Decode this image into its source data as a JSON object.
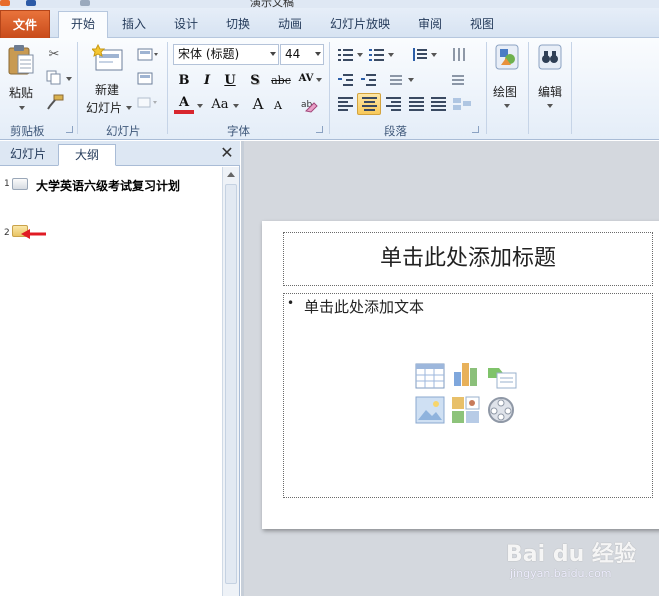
{
  "app": {
    "title_fragment": "演示文稿"
  },
  "tabs": [
    {
      "label": "文件"
    },
    {
      "label": "开始"
    },
    {
      "label": "插入"
    },
    {
      "label": "设计"
    },
    {
      "label": "切换"
    },
    {
      "label": "动画"
    },
    {
      "label": "幻灯片放映"
    },
    {
      "label": "审阅"
    },
    {
      "label": "视图"
    }
  ],
  "ribbon": {
    "clipboard": {
      "paste": "粘贴",
      "group": "剪贴板"
    },
    "slides": {
      "new_line1": "新建",
      "new_line2": "幻灯片",
      "group": "幻灯片"
    },
    "font": {
      "name": "宋体 (标题)",
      "size": "44",
      "bold": "B",
      "italic": "I",
      "underline": "U",
      "shadow": "S",
      "strike": "abc",
      "spacing": "AV",
      "color": "A",
      "case": "Aa",
      "grow": "A",
      "shrink": "A",
      "group": "字体"
    },
    "paragraph": {
      "group": "段落"
    },
    "drawing": {
      "label": "绘图"
    },
    "editing": {
      "label": "编辑"
    }
  },
  "panel": {
    "tab_slides": "幻灯片",
    "tab_outline": "大纲",
    "close_symbol": "✕",
    "items": [
      {
        "number": "1",
        "title": "大学英语六级考试复习计划"
      },
      {
        "number": "2",
        "title": ""
      }
    ]
  },
  "slide": {
    "title_placeholder": "单击此处添加标题",
    "bullet": "•",
    "body_placeholder": "单击此处添加文本"
  },
  "watermark": {
    "logo": "Bai du 经验",
    "site": "jingyan.baidu.com"
  }
}
